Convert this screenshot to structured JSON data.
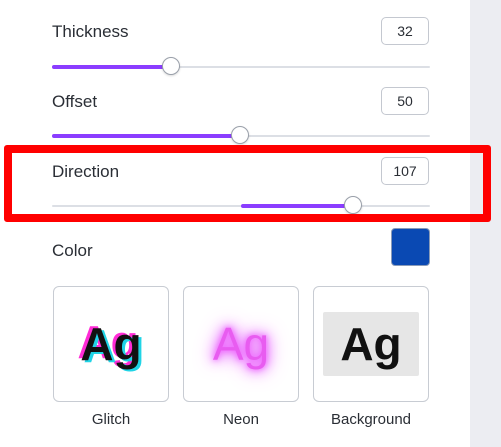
{
  "thickness": {
    "label": "Thickness",
    "value": "32",
    "level": 0.32
  },
  "offset": {
    "label": "Offset",
    "value": "50",
    "level": 0.5
  },
  "direction": {
    "label": "Direction",
    "value": "107",
    "level_start": 0.5,
    "level_end": 0.8
  },
  "color": {
    "label": "Color",
    "swatch": "#0a49b3"
  },
  "accent": "#8b3dff",
  "highlight_color": "#ff0000",
  "effects": [
    {
      "label": "Glitch",
      "sample": "Ag"
    },
    {
      "label": "Neon",
      "sample": "Ag"
    },
    {
      "label": "Background",
      "sample": "Ag"
    }
  ]
}
